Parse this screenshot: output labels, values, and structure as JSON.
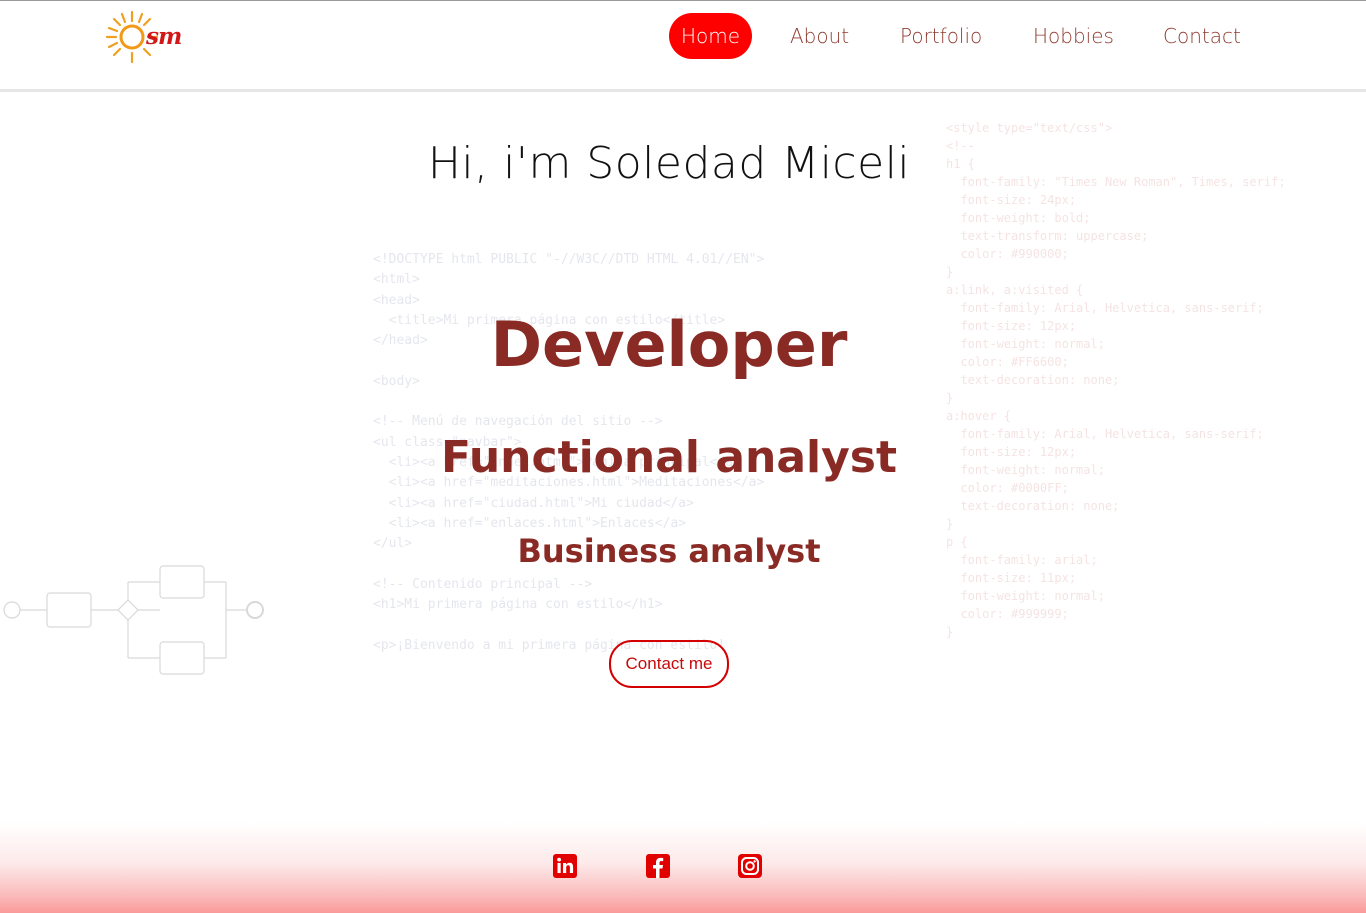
{
  "header": {
    "logo_text": "sm",
    "nav": [
      {
        "label": "Home",
        "active": true
      },
      {
        "label": "About",
        "active": false
      },
      {
        "label": "Portfolio",
        "active": false
      },
      {
        "label": "Hobbies",
        "active": false
      },
      {
        "label": "Contact",
        "active": false
      }
    ]
  },
  "hero": {
    "greeting": "Hi, i'm Soledad Miceli",
    "roles": [
      "Developer",
      "Functional analyst",
      "Business analyst"
    ],
    "cta_label": "Contact me"
  },
  "background": {
    "code_left": "<!DOCTYPE html PUBLIC \"-//W3C//DTD HTML 4.01//EN\">\n<html>\n<head>\n  <title>Mi primera página con estilo</title>\n</head>\n\n<body>\n\n<!-- Menú de navegación del sitio -->\n<ul class=\"navbar\">\n  <li><a href=\"index.html\">Página principal</a>\n  <li><a href=\"meditaciones.html\">Meditaciones</a>\n  <li><a href=\"ciudad.html\">Mi ciudad</a>\n  <li><a href=\"enlaces.html\">Enlaces</a>\n</ul>\n\n<!-- Contenido principal -->\n<h1>Mi primera página con estilo</h1>\n\n<p>¡Bienvendo a mi primera página con estilo!",
    "code_right": "<style type=\"text/css\">\n<!--\nh1 {\n  font-family: \"Times New Roman\", Times, serif;\n  font-size: 24px;\n  font-weight: bold;\n  text-transform: uppercase;\n  color: #990000;\n}\na:link, a:visited {\n  font-family: Arial, Helvetica, sans-serif;\n  font-size: 12px;\n  font-weight: normal;\n  color: #FF6600;\n  text-decoration: none;\n}\na:hover {\n  font-family: Arial, Helvetica, sans-serif;\n  font-size: 12px;\n  font-weight: normal;\n  color: #0000FF;\n  text-decoration: none;\n}\np {\n  font-family: arial;\n  font-size: 11px;\n  font-weight: normal;\n  color: #999999;\n}"
  },
  "footer": {
    "social": [
      {
        "name": "linkedin-icon"
      },
      {
        "name": "facebook-icon"
      },
      {
        "name": "instagram-icon"
      }
    ]
  },
  "colors": {
    "accent": "#ff0000",
    "heading": "#8a2a25",
    "nav_text": "#8e3b30"
  }
}
